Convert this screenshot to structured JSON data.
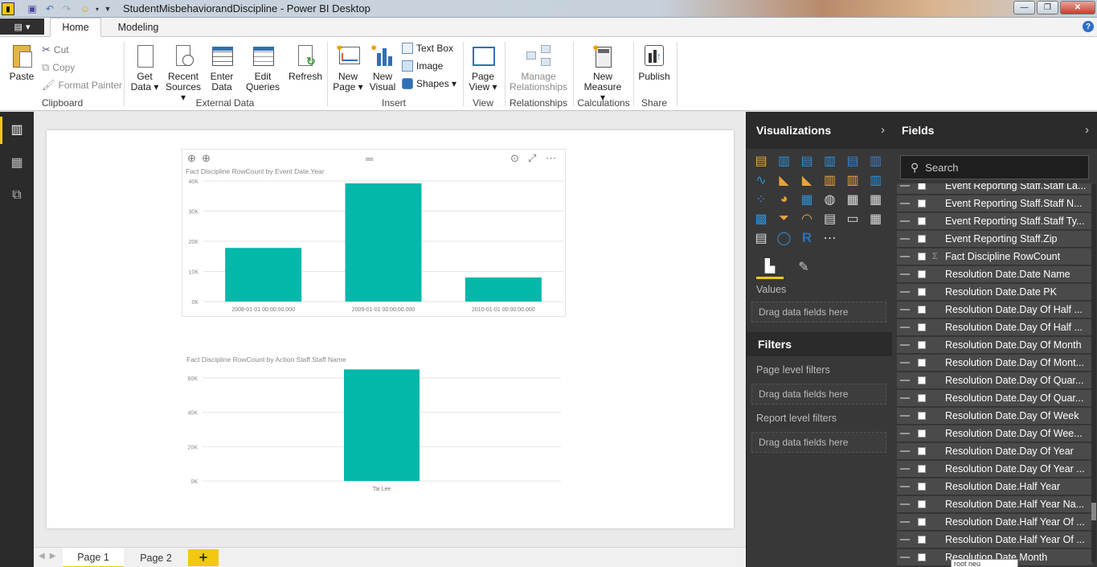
{
  "window": {
    "title": "StudentMisbehaviorandDiscipline - Power BI Desktop"
  },
  "ribbon_tabs": {
    "file": "",
    "home": "Home",
    "modeling": "Modeling"
  },
  "clipboard": {
    "paste": "Paste",
    "cut": "Cut",
    "copy": "Copy",
    "format_painter": "Format Painter",
    "group": "Clipboard"
  },
  "external_data": {
    "get_data_1": "Get",
    "get_data_2": "Data ▾",
    "recent_1": "Recent",
    "recent_2": "Sources ▾",
    "enter_1": "Enter",
    "enter_2": "Data",
    "edit_1": "Edit",
    "edit_2": "Queries",
    "refresh": "Refresh",
    "group": "External Data"
  },
  "insert": {
    "new_page_1": "New",
    "new_page_2": "Page ▾",
    "new_visual_1": "New",
    "new_visual_2": "Visual",
    "text_box": "Text Box",
    "image": "Image",
    "shapes": "Shapes ▾",
    "group": "Insert"
  },
  "view": {
    "page_view_1": "Page",
    "page_view_2": "View ▾",
    "group": "View"
  },
  "relationships": {
    "manage_1": "Manage",
    "manage_2": "Relationships",
    "group": "Relationships"
  },
  "calculations": {
    "new_measure_1": "New",
    "new_measure_2": "Measure ▾",
    "group": "Calculations"
  },
  "share": {
    "publish": "Publish",
    "group": "Share"
  },
  "charts": [
    {
      "title": "Fact Discipline RowCount by Event Date.Year"
    },
    {
      "title": "Fact Discipline RowCount by Action Staff.Staff Name"
    }
  ],
  "chart_data": [
    {
      "type": "bar",
      "title": "Fact Discipline RowCount by Event Date.Year",
      "categories": [
        "2008-01-01 00:00:00.000",
        "2009-01-01 00:00:00.000",
        "2010-01-01 00:00:00.000"
      ],
      "values": [
        17800,
        39200,
        8000
      ],
      "ylim": [
        0,
        40000
      ],
      "yticks": [
        0,
        10000,
        20000,
        30000,
        40000
      ],
      "ytick_labels": [
        "0K",
        "10K",
        "20K",
        "30K",
        "40K"
      ],
      "color": "#01b8aa",
      "grid": true
    },
    {
      "type": "bar",
      "title": "Fact Discipline RowCount by Action Staff.Staff Name",
      "categories": [
        "Tai Lee"
      ],
      "values": [
        65000
      ],
      "ylim": [
        0,
        60000
      ],
      "yticks": [
        0,
        20000,
        40000,
        60000
      ],
      "ytick_labels": [
        "0K",
        "20K",
        "40K",
        "60K"
      ],
      "color": "#01b8aa",
      "grid": true
    }
  ],
  "pages": {
    "page1": "Page 1",
    "page2": "Page 2",
    "add": "+"
  },
  "visualizations": {
    "title": "Visualizations",
    "values_label": "Values",
    "drag_values": "Drag data fields here"
  },
  "filters": {
    "title": "Filters",
    "page_level": "Page level filters",
    "drag_page": "Drag data fields here",
    "report_level": "Report level filters",
    "drag_report": "Drag data fields here"
  },
  "fields_panel": {
    "title": "Fields",
    "search_placeholder": "Search",
    "items": [
      {
        "label": "Event Reporting Staff.Staff La...",
        "sigma": false
      },
      {
        "label": "Event Reporting Staff.Staff N...",
        "sigma": false
      },
      {
        "label": "Event Reporting Staff.Staff Ty...",
        "sigma": false
      },
      {
        "label": "Event Reporting Staff.Zip",
        "sigma": false
      },
      {
        "label": "Fact Discipline RowCount",
        "sigma": true
      },
      {
        "label": "Resolution Date.Date Name",
        "sigma": false
      },
      {
        "label": "Resolution Date.Date PK",
        "sigma": false
      },
      {
        "label": "Resolution Date.Day Of Half ...",
        "sigma": false
      },
      {
        "label": "Resolution Date.Day Of Half ...",
        "sigma": false
      },
      {
        "label": "Resolution Date.Day Of Month",
        "sigma": false
      },
      {
        "label": "Resolution Date.Day Of Mont...",
        "sigma": false
      },
      {
        "label": "Resolution Date.Day Of Quar...",
        "sigma": false
      },
      {
        "label": "Resolution Date.Day Of Quar...",
        "sigma": false
      },
      {
        "label": "Resolution Date.Day Of Week",
        "sigma": false
      },
      {
        "label": "Resolution Date.Day Of Wee...",
        "sigma": false
      },
      {
        "label": "Resolution Date.Day Of Year",
        "sigma": false
      },
      {
        "label": "Resolution Date.Day Of Year ...",
        "sigma": false
      },
      {
        "label": "Resolution Date.Half Year",
        "sigma": false
      },
      {
        "label": "Resolution Date.Half Year Na...",
        "sigma": false
      },
      {
        "label": "Resolution Date.Half Year Of ...",
        "sigma": false
      },
      {
        "label": "Resolution Date.Half Year Of ...",
        "sigma": false
      },
      {
        "label": "Resolution Date.Month",
        "sigma": false
      }
    ]
  },
  "tooltip": "root neu",
  "colors": {
    "accent": "#f2c811",
    "bar": "#01b8aa",
    "pane_dark": "#2b2b2b",
    "pane": "#383838"
  }
}
